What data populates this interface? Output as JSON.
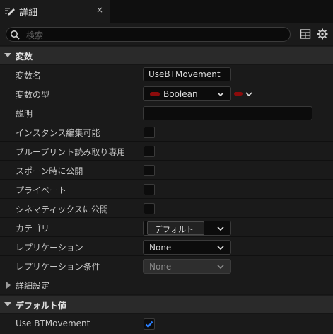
{
  "tab": {
    "title": "詳細",
    "close": "×"
  },
  "search": {
    "placeholder": "検索"
  },
  "sections": {
    "variables": "変数",
    "defaults": "デフォルト値"
  },
  "rows": {
    "var_name": {
      "label": "変数名",
      "value": "UseBTMovement"
    },
    "var_type": {
      "label": "変数の型",
      "value": "Boolean",
      "pin_color": "#8c0b0b"
    },
    "description": {
      "label": "説明",
      "value": ""
    },
    "instance_editable": {
      "label": "インスタンス編集可能",
      "checked": false
    },
    "bp_readonly": {
      "label": "ブループリント読み取り専用",
      "checked": false
    },
    "expose_on_spawn": {
      "label": "スポーン時に公開",
      "checked": false
    },
    "private": {
      "label": "プライベート",
      "checked": false
    },
    "expose_cinematics": {
      "label": "シネマティックスに公開",
      "checked": false
    },
    "category": {
      "label": "カテゴリ",
      "value": "デフォルト"
    },
    "replication": {
      "label": "レプリケーション",
      "value": "None"
    },
    "replication_condition": {
      "label": "レプリケーション条件",
      "value": "None"
    }
  },
  "advanced": {
    "label": "詳細設定"
  },
  "default_value": {
    "label": "Use BTMovement",
    "checked": true
  },
  "colors": {
    "accent": "#2a7fff",
    "bool_pin": "#8c0b0b"
  }
}
